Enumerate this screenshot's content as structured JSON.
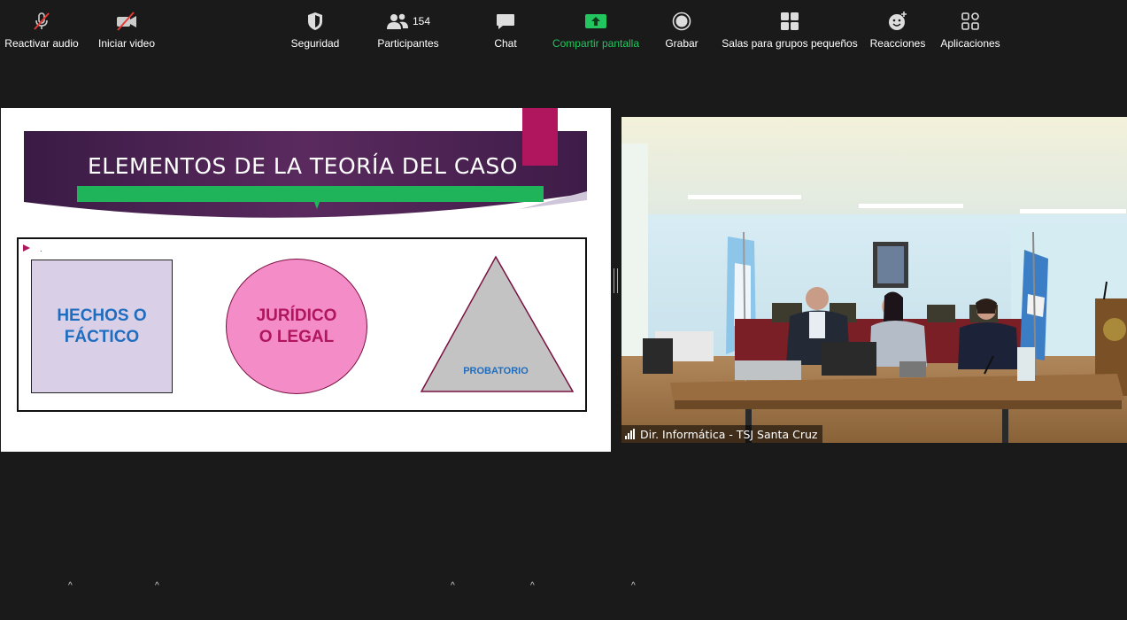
{
  "slide": {
    "title": "ELEMENTOS DE LA TEORÍA DEL CASO",
    "bullet_text": ".",
    "shapes": {
      "square_text": "HECHOS O FÁCTICO",
      "circle_text": "JURÍDICO O LEGAL",
      "triangle_text": "PROBATORIO"
    },
    "colors": {
      "banner": "#4b2150",
      "accent_pink": "#b0165e",
      "green_bar": "#1fb35a",
      "square_fill": "#d9d0e8",
      "circle_fill": "#f48cc8",
      "triangle_fill": "#c3c3c3",
      "blue_text": "#1f6dbf"
    }
  },
  "video": {
    "participant_name": "Dir. Informática - TSJ Santa Cruz"
  },
  "toolbar": {
    "audio_label": "Reactivar audio",
    "video_label": "Iniciar video",
    "security_label": "Seguridad",
    "participants_label": "Participantes",
    "participants_count": "154",
    "chat_label": "Chat",
    "share_label": "Compartir pantalla",
    "record_label": "Grabar",
    "breakout_label": "Salas para grupos pequeños",
    "reactions_label": "Reacciones",
    "apps_label": "Aplicaciones"
  }
}
